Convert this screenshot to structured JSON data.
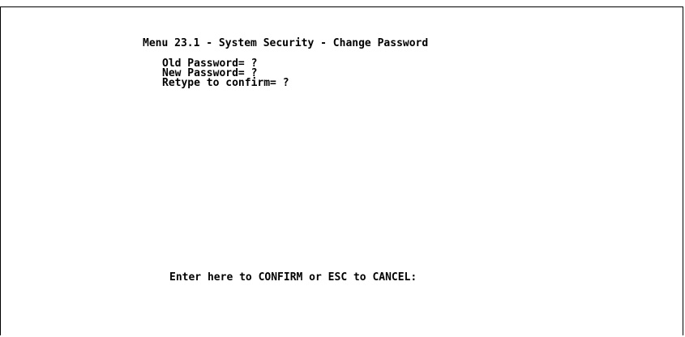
{
  "menu": {
    "title": "Menu 23.1 - System Security - Change Password"
  },
  "fields": [
    {
      "label": "Old Password= ",
      "value": "?"
    },
    {
      "label": "New Password= ",
      "value": "?"
    },
    {
      "label": "Retype to confirm= ",
      "value": "?"
    }
  ],
  "footer": {
    "prompt": "Enter here to CONFIRM or ESC to CANCEL:"
  }
}
